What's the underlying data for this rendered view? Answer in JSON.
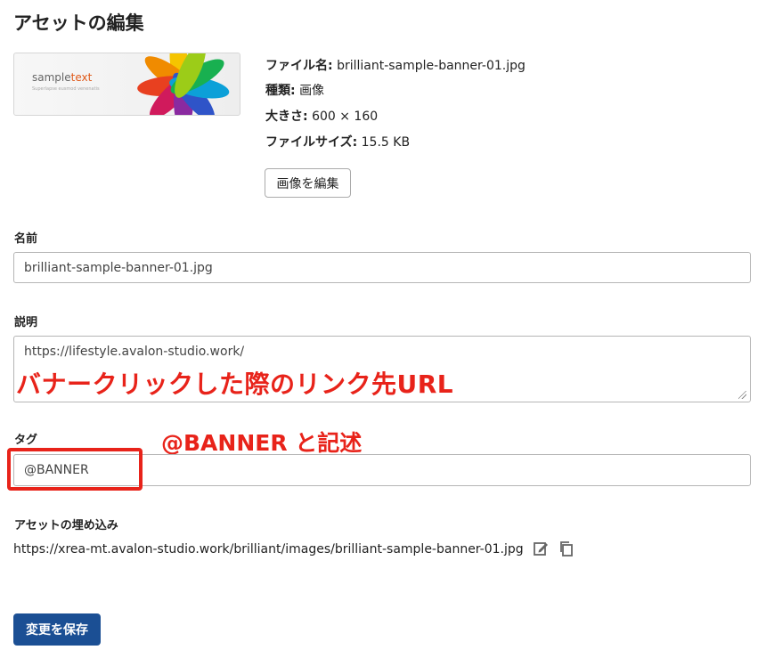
{
  "page": {
    "title": "アセットの編集"
  },
  "preview": {
    "brand_a": "sample",
    "brand_b": "text",
    "tagline": "Superlapse eusmod venenatis"
  },
  "meta": [
    {
      "key": "ファイル名:",
      "value": "brilliant-sample-banner-01.jpg"
    },
    {
      "key": "種類:",
      "value": "画像"
    },
    {
      "key": "大きさ:",
      "value": "600 × 160"
    },
    {
      "key": "ファイルサイズ:",
      "value": "15.5 KB"
    }
  ],
  "edit_image_button": "画像を編集",
  "name": {
    "label": "名前",
    "value": "brilliant-sample-banner-01.jpg"
  },
  "description": {
    "label": "説明",
    "value": "https://lifestyle.avalon-studio.work/"
  },
  "annotations": {
    "description_note": "バナークリックした際のリンク先URL",
    "tag_note": "@BANNER と記述"
  },
  "tag": {
    "label": "タグ",
    "value": "@BANNER"
  },
  "embed": {
    "label": "アセットの埋め込み",
    "url": "https://xrea-mt.avalon-studio.work/brilliant/images/brilliant-sample-banner-01.jpg"
  },
  "save_button": "変更を保存",
  "colors": {
    "accent": "#1b4f94",
    "annotation": "#e8231a"
  },
  "icons": {
    "edit": "edit-icon",
    "copy": "copy-icon"
  }
}
